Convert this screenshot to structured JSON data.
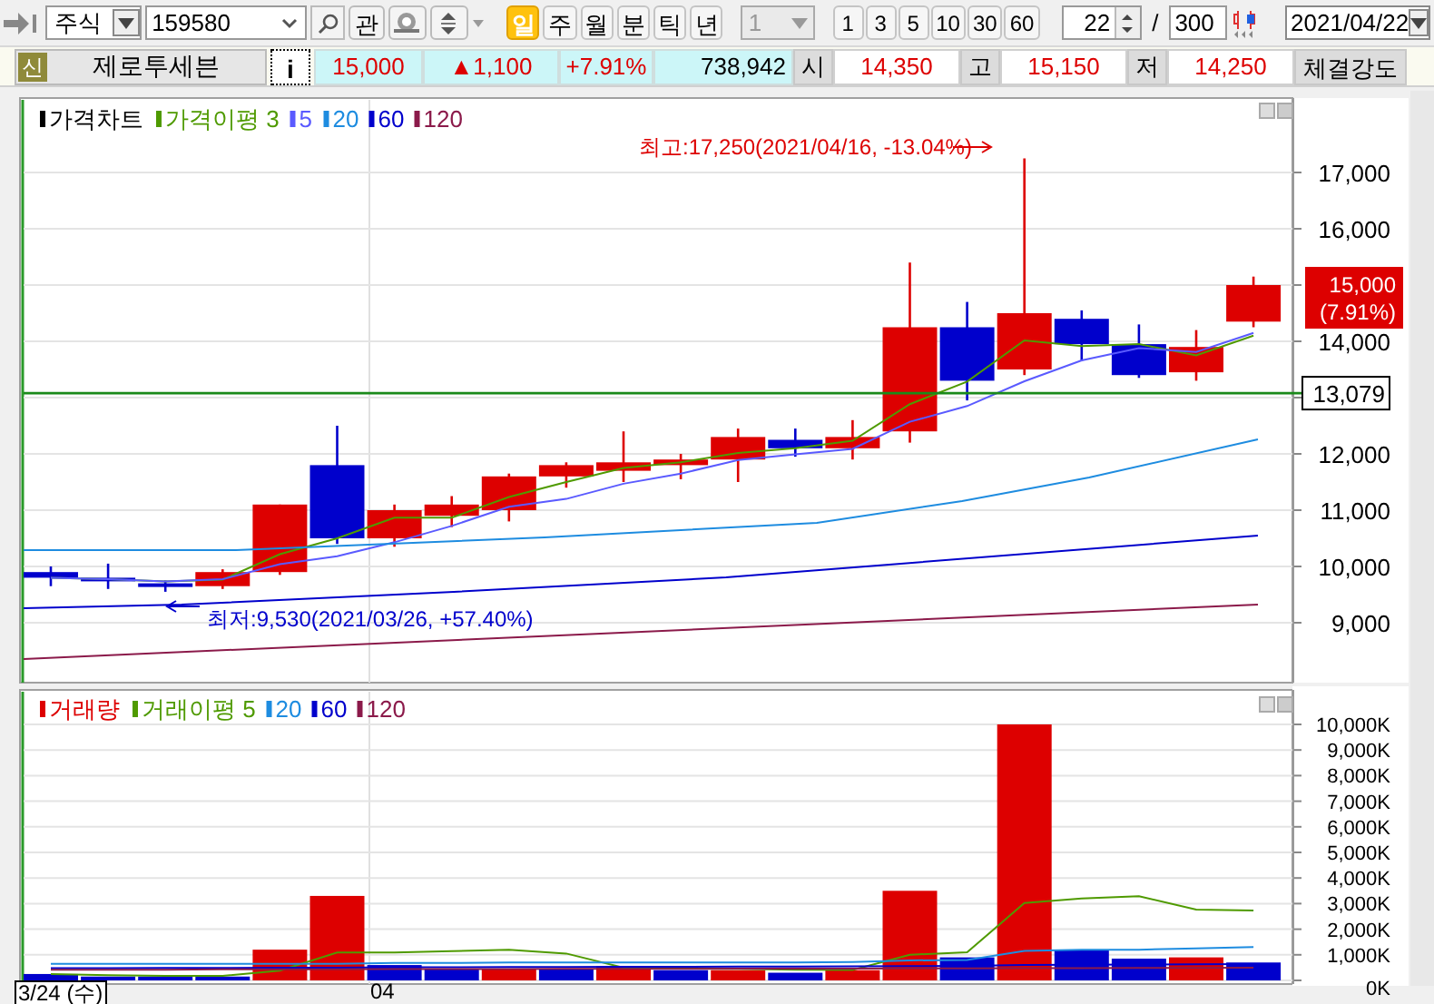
{
  "toolbar": {
    "market": "주식",
    "code": "159580",
    "watch_button": "관",
    "periods": [
      {
        "label": "일",
        "selected": true
      },
      {
        "label": "주",
        "selected": false
      },
      {
        "label": "월",
        "selected": false
      },
      {
        "label": "분",
        "selected": false
      },
      {
        "label": "틱",
        "selected": false
      },
      {
        "label": "년",
        "selected": false
      }
    ],
    "minute_unit": {
      "value": "1",
      "disabled": true
    },
    "intervals": [
      "1",
      "3",
      "5",
      "10",
      "30",
      "60"
    ],
    "count": "22",
    "separator": "/",
    "max_count": "300",
    "date": "2021/04/22"
  },
  "quote": {
    "badge": "신",
    "name": "제로투세븐",
    "info_button": "i",
    "price": "15,000",
    "change_arrow": "▲",
    "change": "1,100",
    "change_rate": "+7.91%",
    "volume": "738,942",
    "fields": [
      {
        "label": "시",
        "value": "14,350"
      },
      {
        "label": "고",
        "value": "15,150"
      },
      {
        "label": "저",
        "value": "14,250"
      }
    ],
    "strength_button": "체결강도"
  },
  "price_chart": {
    "legend": [
      {
        "label": "가격차트",
        "color": "#000000"
      },
      {
        "label": "가격이평 3",
        "color": "#4f9a00"
      },
      {
        "label": "5",
        "color": "#5a5aff"
      },
      {
        "label": "20",
        "color": "#1e8ce0"
      },
      {
        "label": "60",
        "color": "#0000cc"
      },
      {
        "label": "120",
        "color": "#8b1a4a"
      }
    ],
    "high_note": "최고:17,250(2021/04/16, -13.04%)",
    "low_note": "최저:9,530(2021/03/26, +57.40%)",
    "axis_labels": [
      "17,000",
      "16,000",
      "14,000",
      "12,000",
      "11,000",
      "10,000",
      "9,000"
    ],
    "current_price": "15,000",
    "current_rate": "(7.91%)",
    "reference_price": "13,079"
  },
  "volume_chart": {
    "legend": [
      {
        "label": "거래량",
        "color": "#dd0000"
      },
      {
        "label": "거래이평 5",
        "color": "#4f9a00"
      },
      {
        "label": "20",
        "color": "#1e8ce0"
      },
      {
        "label": "60",
        "color": "#0000cc"
      },
      {
        "label": "120",
        "color": "#8b1a4a"
      }
    ],
    "chart_data": {
      "type": "bar",
      "grid": true,
      "ylim": [
        0,
        10000
      ],
      "yticks": [
        {
          "value": 0,
          "label": "0K"
        },
        {
          "value": 1000,
          "label": "1,000K"
        },
        {
          "value": 2000,
          "label": "2,000K"
        },
        {
          "value": 3000,
          "label": "3,000K"
        },
        {
          "value": 4000,
          "label": "4,000K"
        },
        {
          "value": 5000,
          "label": "5,000K"
        },
        {
          "value": 6000,
          "label": "6,000K"
        },
        {
          "value": 7000,
          "label": "7,000K"
        },
        {
          "value": 8000,
          "label": "8,000K"
        },
        {
          "value": 9000,
          "label": "9,000K"
        },
        {
          "value": 10000,
          "label": "10,000K"
        }
      ],
      "series": [
        {
          "color": "#dd0000",
          "values": [
            null,
            null,
            null,
            null,
            1200,
            3300,
            null,
            null,
            450,
            null,
            550,
            null,
            400,
            null,
            400,
            3500,
            null,
            10000,
            null,
            null,
            900,
            null
          ]
        },
        {
          "color": "#0000cc",
          "values": [
            250,
            150,
            150,
            150,
            null,
            null,
            600,
            450,
            null,
            450,
            null,
            400,
            null,
            300,
            null,
            null,
            900,
            null,
            1200,
            850,
            null,
            700
          ]
        },
        {
          "type": "line",
          "color": "#4f9a00",
          "values": [
            250,
            200,
            180,
            180,
            380,
            1090,
            1090,
            1140,
            1200,
            1050,
            500,
            460,
            450,
            420,
            410,
            1000,
            1100,
            3020,
            3200,
            3290,
            2770,
            2730
          ]
        },
        {
          "type": "line",
          "color": "#1e8ce0",
          "values": [
            650,
            650,
            650,
            650,
            650,
            650,
            680,
            680,
            700,
            700,
            700,
            700,
            700,
            700,
            720,
            780,
            800,
            1150,
            1200,
            1200,
            1250,
            1300
          ]
        },
        {
          "type": "line",
          "color": "#0000cc",
          "values": [
            480,
            480,
            490,
            490,
            500,
            500,
            510,
            510,
            520,
            520,
            530,
            530,
            540,
            540,
            550,
            560,
            570,
            600,
            610,
            620,
            630,
            640
          ]
        },
        {
          "type": "line",
          "color": "#8b1a4a",
          "values": [
            420,
            420,
            420,
            430,
            430,
            430,
            440,
            440,
            440,
            450,
            450,
            450,
            460,
            460,
            460,
            470,
            470,
            480,
            480,
            490,
            490,
            500
          ]
        }
      ]
    }
  },
  "x_axis": [
    "3/24 (수)",
    "04"
  ]
}
